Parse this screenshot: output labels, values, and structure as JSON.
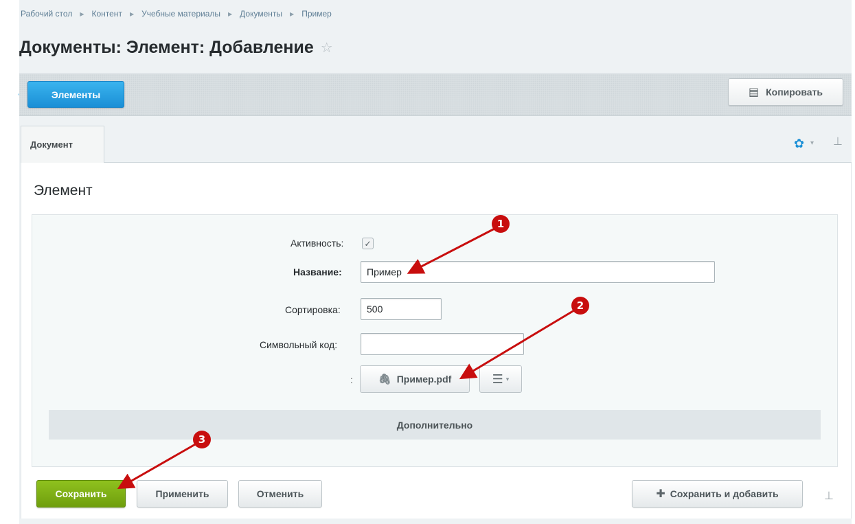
{
  "breadcrumb": [
    "Рабочий стол",
    "Контент",
    "Учебные материалы",
    "Документы",
    "Пример"
  ],
  "page_title": "Документы: Элемент: Добавление",
  "toolbar": {
    "elements_button": "Элементы",
    "copy_button": "Копировать"
  },
  "tabs": [
    {
      "label": "Документ"
    }
  ],
  "section_title": "Элемент",
  "form": {
    "active_label": "Активность:",
    "active_checked": true,
    "name_label": "Название:",
    "name_value": "Пример",
    "sort_label": "Сортировка:",
    "sort_value": "500",
    "code_label": "Символьный код:",
    "code_value": "",
    "file_colon": ":",
    "file_name": "Пример.pdf"
  },
  "additional_section": "Дополнительно",
  "buttons": {
    "save": "Сохранить",
    "apply": "Применить",
    "cancel": "Отменить",
    "save_and_add": "Сохранить и добавить"
  },
  "annotations": [
    "1",
    "2",
    "3"
  ],
  "colors": {
    "accent_blue": "#1a8fd6",
    "save_green": "#7fb015",
    "annotation_red": "#c80e0e"
  },
  "icons": [
    "star-icon",
    "copy-icon",
    "gear-icon",
    "pin-icon",
    "paperclip-icon",
    "menu-icon",
    "plus-icon"
  ]
}
